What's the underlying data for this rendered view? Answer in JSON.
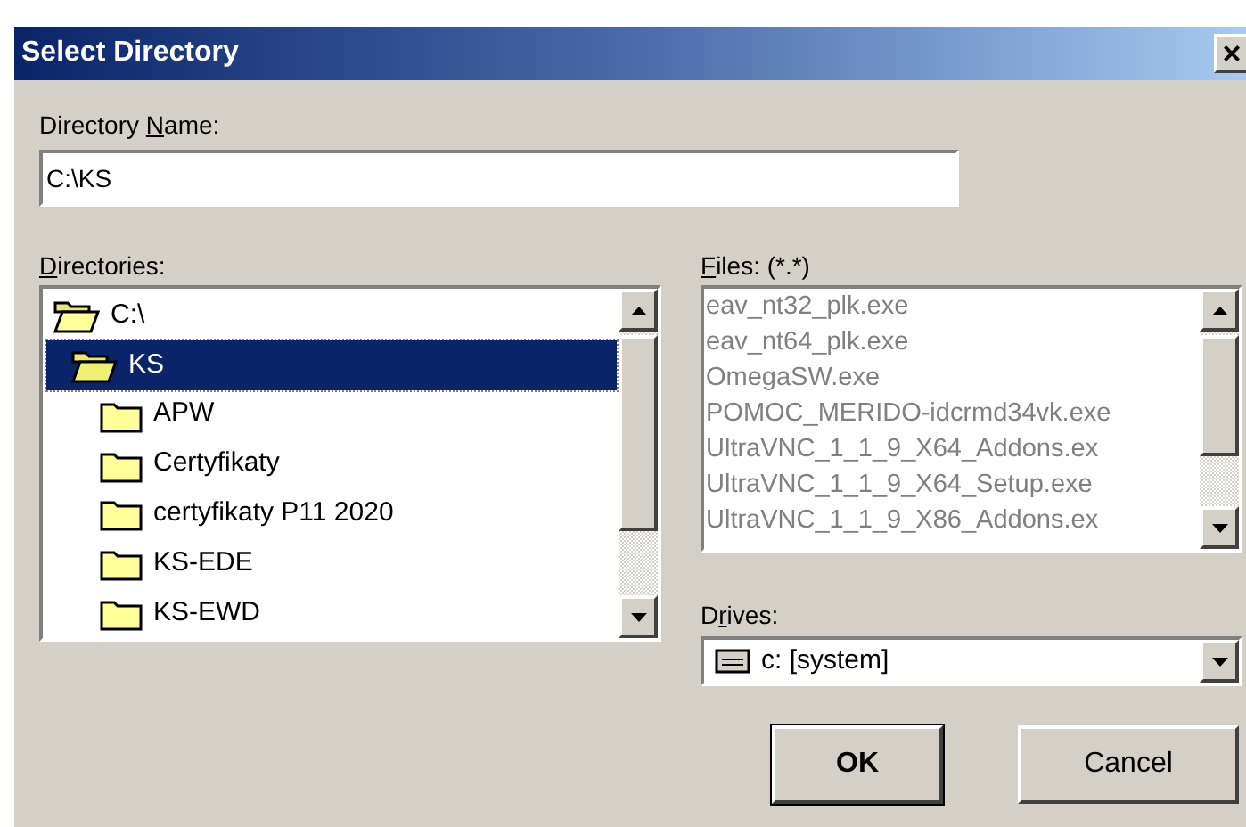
{
  "window": {
    "title": "Select Directory",
    "close": "×"
  },
  "directory_name": {
    "label": {
      "before": "Directory ",
      "key": "N",
      "after": "ame:"
    },
    "value": "C:\\KS"
  },
  "directories": {
    "label": {
      "key": "D",
      "after": "irectories:"
    },
    "items": [
      {
        "name": "C:\\",
        "expanded": true,
        "selected": false,
        "children": [
          {
            "name": "KS",
            "expanded": true,
            "selected": true,
            "children": [
              {
                "name": "APW",
                "expanded": false,
                "selected": false
              },
              {
                "name": "Certyfikaty",
                "expanded": false,
                "selected": false
              },
              {
                "name": "certyfikaty P11 2020",
                "expanded": false,
                "selected": false
              },
              {
                "name": "KS-EDE",
                "expanded": false,
                "selected": false
              },
              {
                "name": "KS-EWD",
                "expanded": false,
                "selected": false
              }
            ]
          }
        ]
      }
    ]
  },
  "files": {
    "label": {
      "key": "F",
      "after": "iles: (*.*)"
    },
    "disabled": true,
    "items": [
      "eav_nt32_plk.exe",
      "eav_nt64_plk.exe",
      "OmegaSW.exe",
      "POMOC_MERIDO-idcrmd34vk.exe",
      "UltraVNC_1_1_9_X64_Addons.ex",
      "UltraVNC_1_1_9_X64_Setup.exe",
      "UltraVNC_1_1_9_X86_Addons.ex"
    ]
  },
  "drives": {
    "label": {
      "before": "D",
      "key": "r",
      "after": "ives:"
    },
    "value": "c: [system]"
  },
  "buttons": [
    {
      "label": "OK",
      "default": true
    },
    {
      "label": "Cancel",
      "default": false
    }
  ]
}
